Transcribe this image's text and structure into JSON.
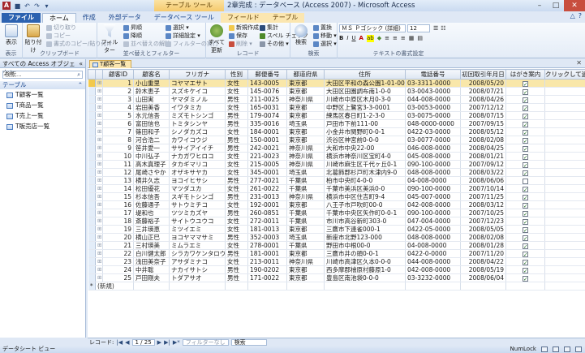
{
  "titlebar": {
    "app_icon": "A",
    "context_tab_title": "テーブル ツール",
    "title": "2章完成 : データベース (Access 2007) - Microsoft Access",
    "minimize": "–",
    "maximize": "□",
    "close": "✕"
  },
  "tabs": {
    "file": "ファイル",
    "home": "ホーム",
    "create": "作成",
    "external": "外部データ",
    "dbtools": "データベース ツール",
    "fields": "フィールド",
    "table": "テーブル",
    "help": "?"
  },
  "ribbon": {
    "view": {
      "label": "表示",
      "group": "表示"
    },
    "clipboard": {
      "group": "クリップボード",
      "paste": "貼り付け",
      "cut": "切り取り",
      "copy": "コピー",
      "format_painter": "書式のコピー/貼り付け"
    },
    "sort": {
      "group": "並べ替えとフィルター",
      "filter": "フィルター",
      "asc": "昇順",
      "desc": "降順",
      "clear": "並べ替えの解除",
      "selection": "選択 ▾",
      "advanced": "詳細設定 ▾",
      "toggle": "フィルターの実行"
    },
    "records": {
      "group": "レコード",
      "refresh": "すべて更新",
      "new": "新規作成",
      "save": "保存",
      "delete": "削除 ▾",
      "totals": "集計",
      "spelling": "スペル チェック",
      "more": "その他 ▾"
    },
    "find": {
      "group": "検索",
      "find": "検索",
      "replace": "置換",
      "goto": "移動 ▾",
      "select": "選択 ▾"
    },
    "text": {
      "group": "テキストの書式設定",
      "font": "ＭＳ Ｐゴシック (詳細)",
      "size": "12",
      "bold": "B",
      "italic": "I",
      "underline": "U"
    }
  },
  "nav": {
    "header": "すべての Access オブジェクト",
    "search_placeholder": "検索...",
    "group": "テーブル",
    "items": [
      "T顧客一覧",
      "T商品一覧",
      "T売上一覧",
      "T販売店一覧"
    ]
  },
  "doc_tab": {
    "label": "T顧客一覧"
  },
  "grid": {
    "columns": [
      "顧客ID",
      "顧客名",
      "フリガナ",
      "性別",
      "郵便番号",
      "都道府県",
      "住所",
      "電話番号",
      "初回取引年月日",
      "はがき案内",
      "クリックして追加"
    ],
    "rows": [
      [
        "1",
        "小山重里",
        "コヤマエサト",
        "女性",
        "143-0005",
        "東京都",
        "大田区平和の森公園1-01-000",
        "03-3311-0000",
        "2008/05/20",
        true
      ],
      [
        "2",
        "鈴木恵子",
        "スズキケイコ",
        "女性",
        "145-0076",
        "東京都",
        "大田区田園調布南1-0-0",
        "03-0043-0000",
        "2008/07/21",
        true
      ],
      [
        "3",
        "山田実",
        "ヤマダミノル",
        "男性",
        "211-0025",
        "神奈川県",
        "川崎市中原区木月0-3-0",
        "044-008-0000",
        "2008/04/26",
        true
      ],
      [
        "4",
        "岩田美香",
        "イワタミカ",
        "女性",
        "165-0031",
        "東京都",
        "中野区上鷺宮3-3-0001",
        "03-0053-0000",
        "2007/12/12",
        true
      ],
      [
        "5",
        "水元信吾",
        "ミズモトシンゴ",
        "男性",
        "179-0074",
        "東京都",
        "練馬区春日町1-2-3-0",
        "03-0075-0000",
        "2008/07/15",
        true
      ],
      [
        "6",
        "富田信也",
        "トミタシンヤ",
        "男性",
        "335-0016",
        "埼玉県",
        "戸田市下前111-00",
        "048-0000-0000",
        "2007/09/15",
        true
      ],
      [
        "7",
        "篠田和子",
        "シノダカズコ",
        "女性",
        "184-0001",
        "東京都",
        "小金井市関野町0-0-1",
        "0422-03-0000",
        "2008/05/12",
        true
      ],
      [
        "8",
        "河合浩二",
        "カワイコウジ",
        "男性",
        "150-0001",
        "東京都",
        "渋谷区神宮前0-0-0",
        "03-0077-0000",
        "2008/02/08",
        true
      ],
      [
        "9",
        "笹井愛一",
        "ササイアイイチ",
        "男性",
        "242-0021",
        "神奈川県",
        "大和市中央22-00",
        "046-008-0000",
        "2008/04/25",
        true
      ],
      [
        "10",
        "中川弘子",
        "ナカガワヒロコ",
        "女性",
        "221-0023",
        "神奈川県",
        "横浜市神奈川区宝町4-0",
        "045-008-0000",
        "2008/01/21",
        true
      ],
      [
        "11",
        "高木真理子",
        "タカギマリコ",
        "女性",
        "215-0005",
        "神奈川県",
        "川崎市麻生区千代ヶ丘0-1",
        "090-100-0000",
        "2007/09/12",
        true
      ],
      [
        "12",
        "尾崎さやか",
        "オザキサヤカ",
        "女性",
        "345-0001",
        "埼玉県",
        "北葛飾郡杉戸町木津内9-0",
        "048-008-0000",
        "2008/03/22",
        true
      ],
      [
        "13",
        "横井久志",
        "ヨコイヒサシ",
        "男性",
        "277-0021",
        "千葉県",
        "柏市中央町4-0-0",
        "04-008-0000",
        "2008/06/06",
        false
      ],
      [
        "14",
        "松田優花",
        "マツダユカ",
        "女性",
        "261-0022",
        "千葉県",
        "千葉市美浜区美浜0-0",
        "090-100-0000",
        "2007/10/14",
        true
      ],
      [
        "15",
        "杉本信吾",
        "スギモトシンゴ",
        "男性",
        "231-0013",
        "神奈川県",
        "横浜市中区住吉町9-4",
        "045-007-0000",
        "2007/11/25",
        true
      ],
      [
        "16",
        "佐藤通子",
        "サトウミチコ",
        "女性",
        "192-0001",
        "東京都",
        "八王子市戸吹町00-0",
        "042-008-0000",
        "2008/03/12",
        true
      ],
      [
        "17",
        "堤和也",
        "ツツミカズヤ",
        "男性",
        "260-0851",
        "千葉県",
        "千葉市中央区矢作町0-0-1",
        "090-100-0000",
        "2007/10/25",
        true
      ],
      [
        "18",
        "斎藤裕子",
        "サイトウユウコ",
        "女性",
        "272-0011",
        "千葉県",
        "市川市高谷新町303-0",
        "047-004-0000",
        "2007/12/23",
        true
      ],
      [
        "19",
        "三井瑛恵",
        "ミツイエミ",
        "女性",
        "181-0013",
        "東京都",
        "三鷹市下連雀000-1",
        "0422-05-0000",
        "2008/05/05",
        true
      ],
      [
        "20",
        "横山正巳",
        "ヨコヤママサミ",
        "男性",
        "352-0003",
        "埼玉県",
        "新座市北野123-000",
        "048-008-0000",
        "2008/02/08",
        true
      ],
      [
        "21",
        "三村瑛美",
        "ミムラエミ",
        "女性",
        "278-0001",
        "千葉県",
        "野田市中根00-0",
        "04-008-0000",
        "2008/01/28",
        true
      ],
      [
        "22",
        "白川健太郎",
        "シラカワケンタロウ",
        "男性",
        "181-0001",
        "東京都",
        "三鷹市井の頭0-0-1",
        "0422-0-0000",
        "2007/11/20",
        true
      ],
      [
        "23",
        "浅田美奈子",
        "アサダミナコ",
        "女性",
        "213-0011",
        "神奈川県",
        "川崎市高津区久本0-0-0",
        "044-008-0000",
        "2008/04/22",
        true
      ],
      [
        "24",
        "中井聡",
        "ナカイサトシ",
        "男性",
        "190-0202",
        "東京都",
        "西多摩郡檜原村藤原1-0",
        "042-008-0000",
        "2008/05/19",
        true
      ],
      [
        "25",
        "戸田剛夫",
        "トダアサオ",
        "男性",
        "171-0022",
        "東京都",
        "豊島区南池袋0-0-0",
        "03-3232-0000",
        "2008/06/04",
        true
      ]
    ],
    "new_row": "(新規)",
    "check_mark": "✓"
  },
  "recnav": {
    "label": "レコード:",
    "first": "|◀",
    "prev": "◀",
    "position": "1 / 25",
    "next": "▶",
    "last": "▶|",
    "new": "▶*",
    "filter": "フィルターなし",
    "search": "検索"
  },
  "status": {
    "left": "データシート ビュー",
    "numlock": "NumLock"
  }
}
